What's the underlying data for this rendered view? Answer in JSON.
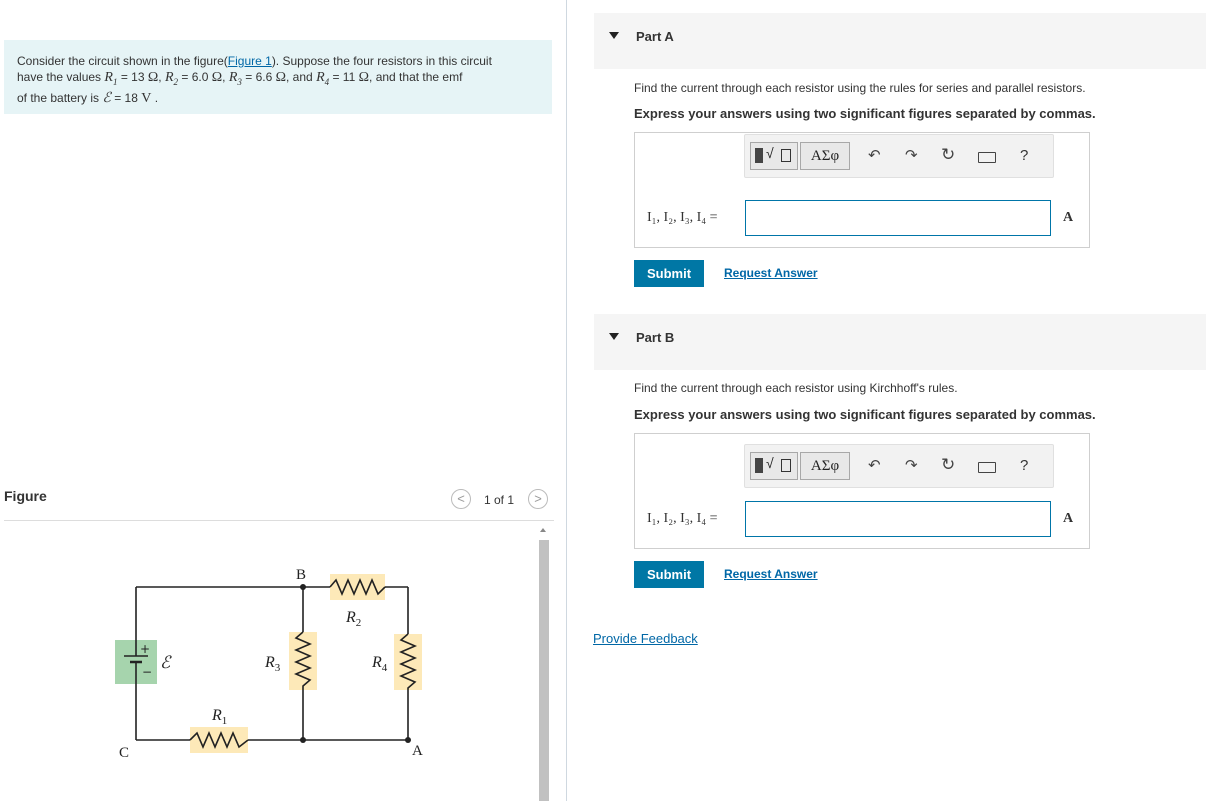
{
  "problem": {
    "line1_pre": "Consider the circuit shown in the figure(",
    "figure_link": "Figure 1",
    "line1_post": "). Suppose the four resistors in this circuit",
    "line2_pre": "have the values",
    "R1_sym": "R",
    "R1_sub": "1",
    "R1_val": "= 13",
    "R2_sym": "R",
    "R2_sub": "2",
    "R2_val": "= 6.0",
    "R3_sym": "R",
    "R3_sub": "3",
    "R3_val": "= 6.6",
    "and_word": ", and",
    "R4_sym": "R",
    "R4_sub": "4",
    "R4_val": "= 11",
    "line2_post": ", and that the emf",
    "line3_pre": "of the battery is",
    "emf_sym": "ℰ",
    "emf_val": "= 18",
    "emf_unit": "V",
    "ohm": "Ω",
    "comma": ","
  },
  "figure": {
    "label": "Figure",
    "pager": "1 of 1",
    "prev": "<",
    "next": ">",
    "nodes": {
      "B": "B",
      "C": "C",
      "A": "A"
    },
    "emf_label": "ℰ",
    "plus": "+",
    "minus": "−",
    "resistors": {
      "R1": "R",
      "R1_sub": "1",
      "R2": "R",
      "R2_sub": "2",
      "R3": "R",
      "R3_sub": "3",
      "R4": "R",
      "R4_sub": "4"
    }
  },
  "partA": {
    "title": "Part A",
    "instruction": "Find the current through each resistor using the rules for series and parallel resistors.",
    "express": "Express your answers using two significant figures separated by commas.",
    "vars": "I₁, I₂, I₃, I₄ =",
    "unit": "A",
    "submit": "Submit",
    "request": "Request Answer",
    "input_value": ""
  },
  "partB": {
    "title": "Part B",
    "instruction": "Find the current through each resistor using Kirchhoff's rules.",
    "express": "Express your answers using two significant figures separated by commas.",
    "vars": "I₁, I₂, I₃, I₄ =",
    "unit": "A",
    "submit": "Submit",
    "request": "Request Answer",
    "input_value": ""
  },
  "toolbar": {
    "greek": "ΑΣφ",
    "help": "?",
    "icons": [
      "templates-icon",
      "greek-icon",
      "undo-icon",
      "redo-icon",
      "reset-icon",
      "keyboard-icon",
      "help-icon"
    ]
  },
  "feedback": "Provide Feedback",
  "colors": {
    "accent": "#0077a5",
    "link": "#0067a6",
    "problem_bg": "#e6f4f6",
    "resistor_bg": "#fde9b8",
    "battery_bg": "#a6d4ad"
  }
}
